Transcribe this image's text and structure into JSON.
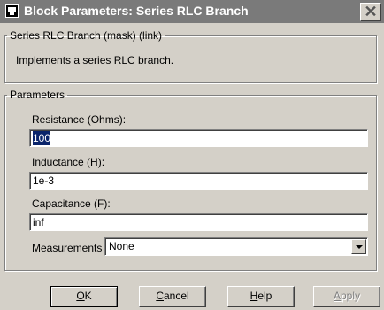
{
  "window": {
    "title": "Block Parameters: Series RLC Branch",
    "close_glyph": "✕"
  },
  "mask_group": {
    "legend": "Series RLC Branch (mask) (link)",
    "description": "Implements a series RLC branch."
  },
  "params_group": {
    "legend": "Parameters",
    "resistance": {
      "label": "Resistance (Ohms):",
      "value": "100"
    },
    "inductance": {
      "label": "Inductance (H):",
      "value": "1e-3"
    },
    "capacitance": {
      "label": "Capacitance (F):",
      "value": "inf"
    },
    "measurements": {
      "label": "Measurements",
      "selected": "None"
    }
  },
  "buttons": {
    "ok": {
      "mnemonic": "O",
      "rest": "K"
    },
    "cancel": {
      "mnemonic": "C",
      "rest": "ancel"
    },
    "help": {
      "mnemonic": "H",
      "rest": "elp"
    },
    "apply": {
      "mnemonic": "A",
      "rest": "pply"
    }
  }
}
